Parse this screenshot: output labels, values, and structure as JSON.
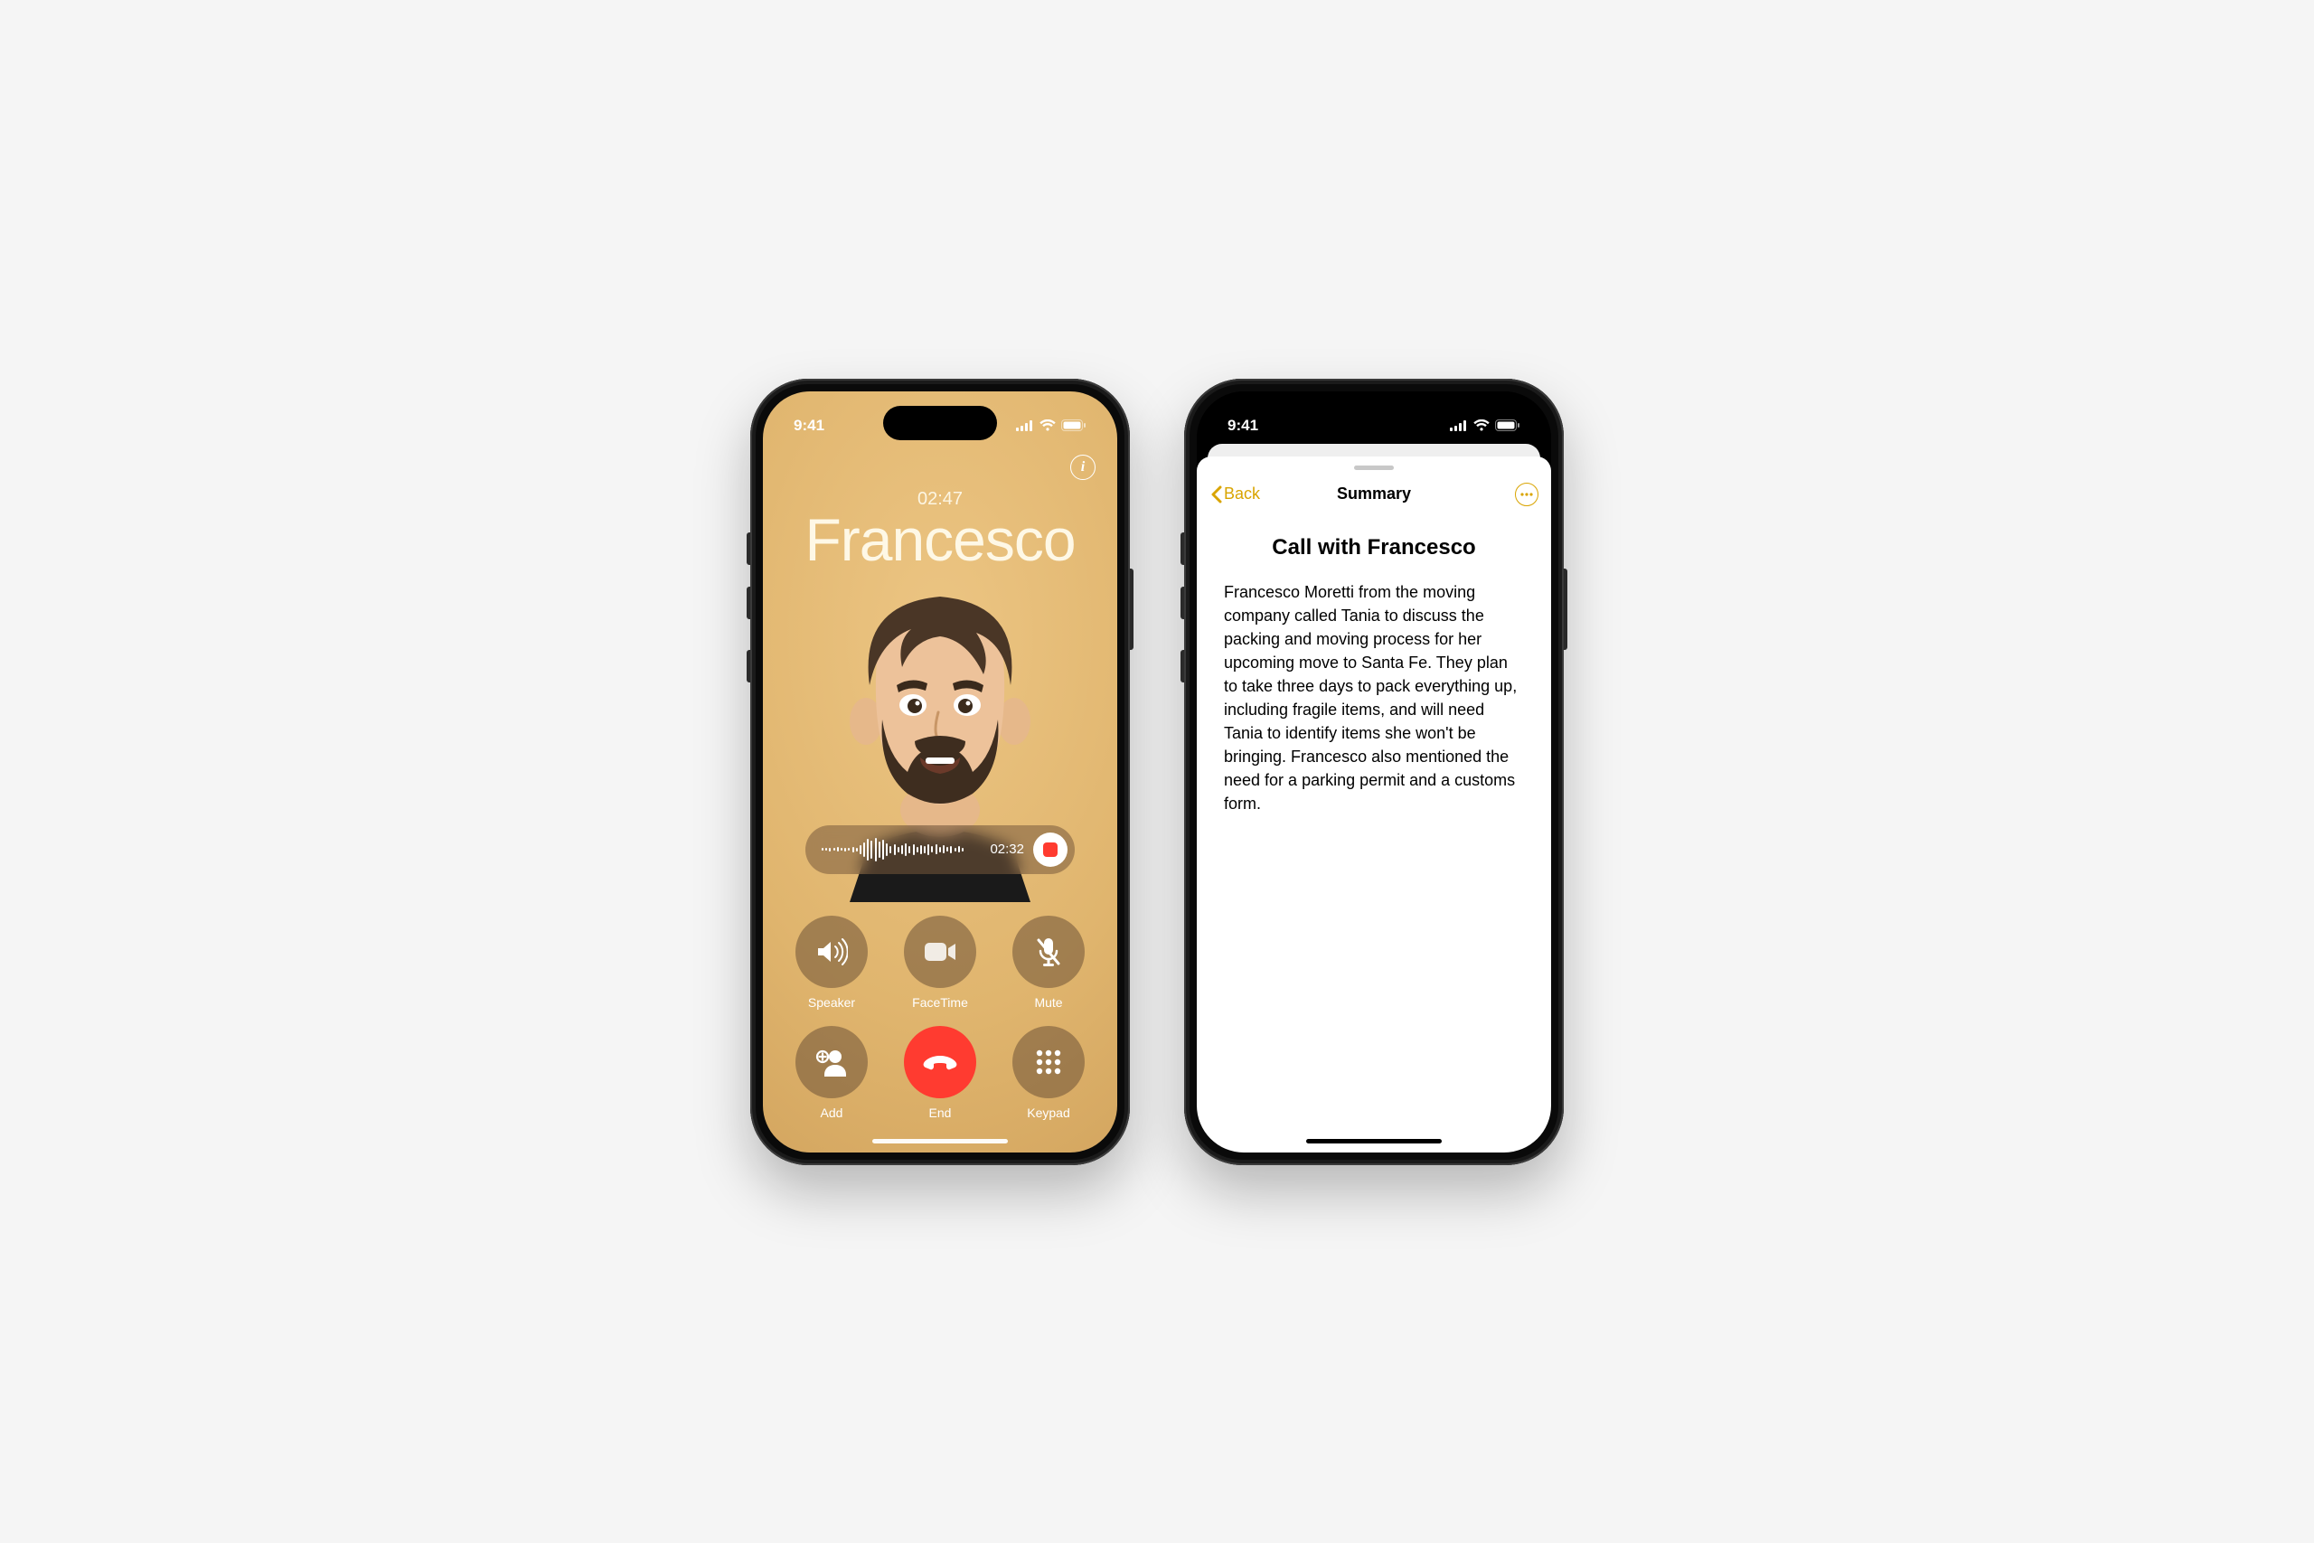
{
  "status": {
    "time": "9:41"
  },
  "colors": {
    "accent_notes": "#d9a400",
    "end_call": "#ff3b30",
    "call_bg_top": "#ecc583",
    "call_bg_bottom": "#cfa05a"
  },
  "call": {
    "duration": "02:47",
    "contact_name": "Francesco",
    "recording_time": "02:32",
    "controls": {
      "speaker": "Speaker",
      "facetime": "FaceTime",
      "mute": "Mute",
      "add": "Add",
      "end": "End",
      "keypad": "Keypad"
    }
  },
  "notes": {
    "back_label": "Back",
    "header_title": "Summary",
    "title": "Call with Francesco",
    "body": "Francesco Moretti from the moving company called Tania to discuss the packing and moving process for her upcoming move to Santa Fe. They plan to take three days to pack everything up, including fragile items, and will need Tania to identify items she won't be bringing. Francesco also mentioned the need for a parking permit and a customs form."
  }
}
